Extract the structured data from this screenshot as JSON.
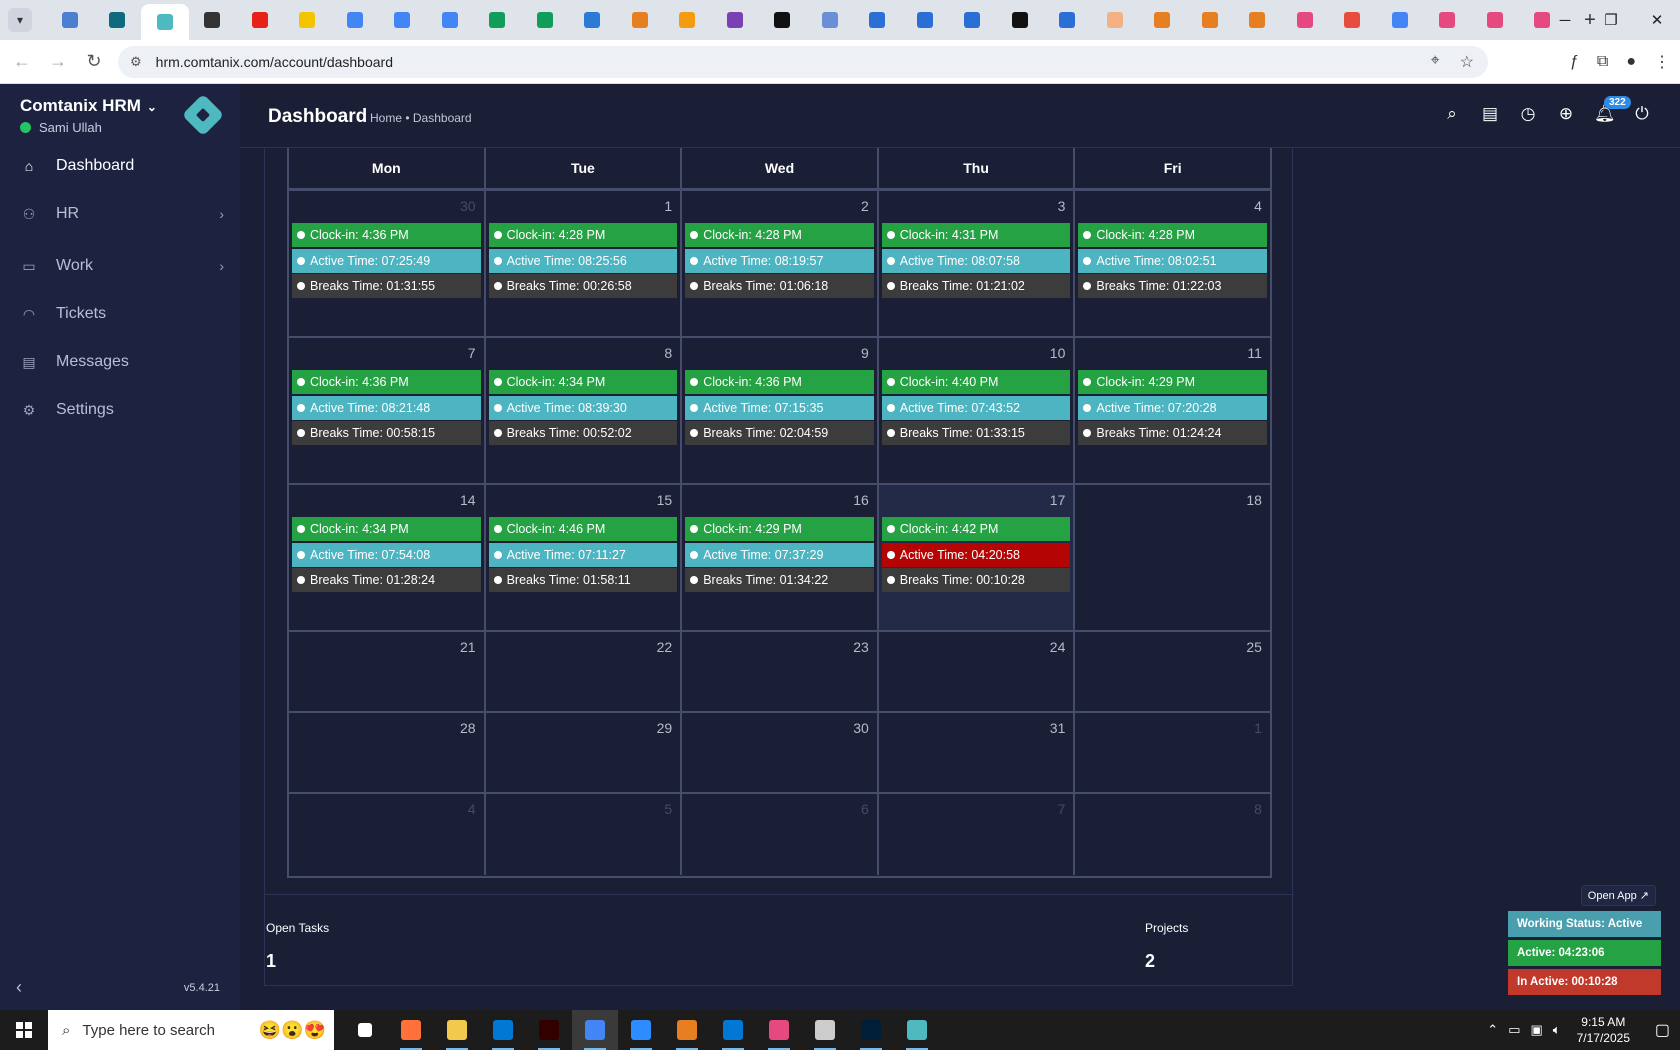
{
  "browser": {
    "url": "hrm.comtanix.com/account/dashboard",
    "tab_colors": [
      "#4a7fd1",
      "#0e6b7e",
      "#4fb9c2",
      "#333333",
      "#e62117",
      "#f5c400",
      "#4285f4",
      "#4285f4",
      "#4285f4",
      "#0f9d58",
      "#0f9d58",
      "#2b7bd6",
      "#e67e22",
      "#f39c12",
      "#7b3fb5",
      "#111111",
      "#6b8fd6",
      "#2b6fd6",
      "#2b6fd6",
      "#2b6fd6",
      "#111111",
      "#2b6fd6",
      "#f4b183",
      "#e67e22",
      "#e67e22",
      "#e67e22",
      "#e64980",
      "#e74c3c",
      "#4285f4",
      "#e64980",
      "#e64980",
      "#e64980"
    ]
  },
  "sidebar": {
    "brand": "Comtanix HRM",
    "user": "Sami Ullah",
    "items": [
      {
        "label": "Dashboard",
        "icon": "home-icon",
        "active": true,
        "has_children": false
      },
      {
        "label": "HR",
        "icon": "users-icon",
        "active": false,
        "has_children": true
      },
      {
        "label": "Work",
        "icon": "briefcase-icon",
        "active": false,
        "has_children": true
      },
      {
        "label": "Tickets",
        "icon": "headset-icon",
        "active": false,
        "has_children": false
      },
      {
        "label": "Messages",
        "icon": "message-icon",
        "active": false,
        "has_children": false
      },
      {
        "label": "Settings",
        "icon": "gear-icon",
        "active": false,
        "has_children": false
      }
    ],
    "version": "v5.4.21"
  },
  "header": {
    "title": "Dashboard",
    "breadcrumb": "Home • Dashboard",
    "notification_count": "322"
  },
  "calendar": {
    "weekdays": [
      "Mon",
      "Tue",
      "Wed",
      "Thu",
      "Fri"
    ],
    "weeks": [
      [
        {
          "day": "30",
          "muted": true,
          "events": [
            "Clock-in: 4:36 PM",
            "Active Time: 07:25:49",
            "Breaks Time: 01:31:55"
          ]
        },
        {
          "day": "1",
          "events": [
            "Clock-in: 4:28 PM",
            "Active Time: 08:25:56",
            "Breaks Time: 00:26:58"
          ]
        },
        {
          "day": "2",
          "events": [
            "Clock-in: 4:28 PM",
            "Active Time: 08:19:57",
            "Breaks Time: 01:06:18"
          ]
        },
        {
          "day": "3",
          "events": [
            "Clock-in: 4:31 PM",
            "Active Time: 08:07:58",
            "Breaks Time: 01:21:02"
          ]
        },
        {
          "day": "4",
          "events": [
            "Clock-in: 4:28 PM",
            "Active Time: 08:02:51",
            "Breaks Time: 01:22:03"
          ]
        }
      ],
      [
        {
          "day": "7",
          "events": [
            "Clock-in: 4:36 PM",
            "Active Time: 08:21:48",
            "Breaks Time: 00:58:15"
          ]
        },
        {
          "day": "8",
          "events": [
            "Clock-in: 4:34 PM",
            "Active Time: 08:39:30",
            "Breaks Time: 00:52:02"
          ]
        },
        {
          "day": "9",
          "events": [
            "Clock-in: 4:36 PM",
            "Active Time: 07:15:35",
            "Breaks Time: 02:04:59"
          ]
        },
        {
          "day": "10",
          "events": [
            "Clock-in: 4:40 PM",
            "Active Time: 07:43:52",
            "Breaks Time: 01:33:15"
          ]
        },
        {
          "day": "11",
          "events": [
            "Clock-in: 4:29 PM",
            "Active Time: 07:20:28",
            "Breaks Time: 01:24:24"
          ]
        }
      ],
      [
        {
          "day": "14",
          "events": [
            "Clock-in: 4:34 PM",
            "Active Time: 07:54:08",
            "Breaks Time: 01:28:24"
          ]
        },
        {
          "day": "15",
          "events": [
            "Clock-in: 4:46 PM",
            "Active Time: 07:11:27",
            "Breaks Time: 01:58:11"
          ]
        },
        {
          "day": "16",
          "events": [
            "Clock-in: 4:29 PM",
            "Active Time: 07:37:29",
            "Breaks Time: 01:34:22"
          ]
        },
        {
          "day": "17",
          "today": true,
          "active_alert": true,
          "events": [
            "Clock-in: 4:42 PM",
            "Active Time: 04:20:58",
            "Breaks Time: 00:10:28"
          ]
        },
        {
          "day": "18",
          "events": []
        }
      ],
      [
        {
          "day": "21",
          "events": []
        },
        {
          "day": "22",
          "events": []
        },
        {
          "day": "23",
          "events": []
        },
        {
          "day": "24",
          "events": []
        },
        {
          "day": "25",
          "events": []
        }
      ],
      [
        {
          "day": "28",
          "events": []
        },
        {
          "day": "29",
          "events": []
        },
        {
          "day": "30",
          "events": []
        },
        {
          "day": "31",
          "events": []
        },
        {
          "day": "1",
          "muted": true,
          "events": []
        }
      ],
      [
        {
          "day": "4",
          "muted": true,
          "events": []
        },
        {
          "day": "5",
          "muted": true,
          "events": []
        },
        {
          "day": "6",
          "muted": true,
          "events": []
        },
        {
          "day": "7",
          "muted": true,
          "events": []
        },
        {
          "day": "8",
          "muted": true,
          "events": []
        }
      ]
    ]
  },
  "stats": {
    "open_tasks_label": "Open Tasks",
    "open_tasks_value": "1",
    "projects_label": "Projects",
    "projects_value": "2"
  },
  "widget": {
    "open_app": "Open App ↗",
    "status": "Working Status: Active",
    "active": "Active: 04:23:06",
    "inactive": "In Active: 00:10:28"
  },
  "taskbar": {
    "search_placeholder": "Type here to search",
    "time": "9:15 AM",
    "date": "7/17/2025",
    "app_colors": [
      "#ffffff",
      "#ff7139",
      "#f2c94c",
      "#0078d4",
      "#330000",
      "#4285f4",
      "#2d8cff",
      "#e67e22",
      "#0078d4",
      "#e64980",
      "#cccccc",
      "#001e36",
      "#4fb9c2"
    ]
  }
}
